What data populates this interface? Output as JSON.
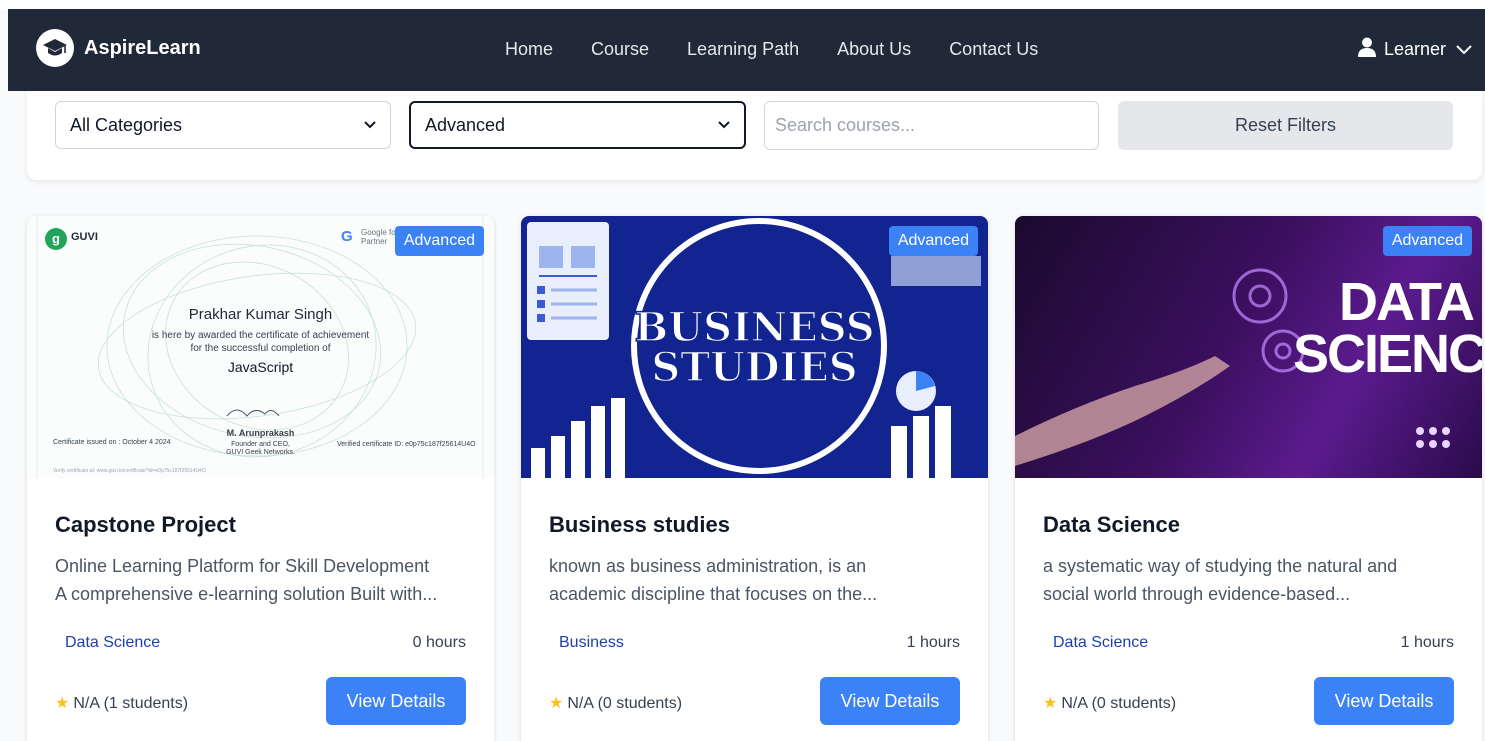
{
  "navbar": {
    "brand": "AspireLearn",
    "links": [
      "Home",
      "Course",
      "Learning Path",
      "About Us",
      "Contact Us"
    ],
    "user_label": "Learner"
  },
  "filters": {
    "category_selected": "All Categories",
    "level_selected": "Advanced",
    "search_placeholder": "Search courses...",
    "reset_label": "Reset Filters"
  },
  "courses": [
    {
      "badge": "Advanced",
      "title": "Capstone Project",
      "desc_line1": "Online Learning Platform for Skill Development",
      "desc_line2": "A comprehensive e-learning solution Built with...",
      "category": "Data Science",
      "hours": "0 hours",
      "rating": "N/A (1 students)",
      "button": "View Details",
      "image": {
        "guvi": "GUVI",
        "google_partner": "Google for Education\nPartner",
        "name": "Prakhar Kumar Singh",
        "line1": "is here by awarded the certificate of achievement",
        "line2": "for the successful completion of",
        "course": "JavaScript",
        "signer": "M. Arunprakash",
        "signer_title": "Founder and CEO,",
        "signer_org": "GUVI Geek Networks.",
        "issued": "Certificate issued on : October 4 2024",
        "verified": "Verified certificate ID: e0p75c187f25614U4O",
        "verify_url": "Verify certificate at: www.guvi.in/certificate?id=e0p75c187f25614U4O"
      }
    },
    {
      "badge": "Advanced",
      "title": "Business studies",
      "desc_line1": "known as business administration, is an",
      "desc_line2": "academic discipline that focuses on the...",
      "category": "Business",
      "hours": "1 hours",
      "rating": "N/A (0 students)",
      "button": "View Details",
      "image": {
        "line1": "BUSINESS",
        "line2": "STUDIES"
      }
    },
    {
      "badge": "Advanced",
      "title": "Data Science",
      "desc_line1": "a systematic way of studying the natural and",
      "desc_line2": "social world through evidence-based...",
      "category": "Data Science",
      "hours": "1 hours",
      "rating": "N/A (0 students)",
      "button": "View Details",
      "image": {
        "line1": "DATA",
        "line2": "SCIENCE"
      }
    }
  ],
  "colors": {
    "navbar": "#1f2937",
    "primary": "#3b82f6",
    "category_text": "#1e40af",
    "star": "#fbbf24"
  }
}
